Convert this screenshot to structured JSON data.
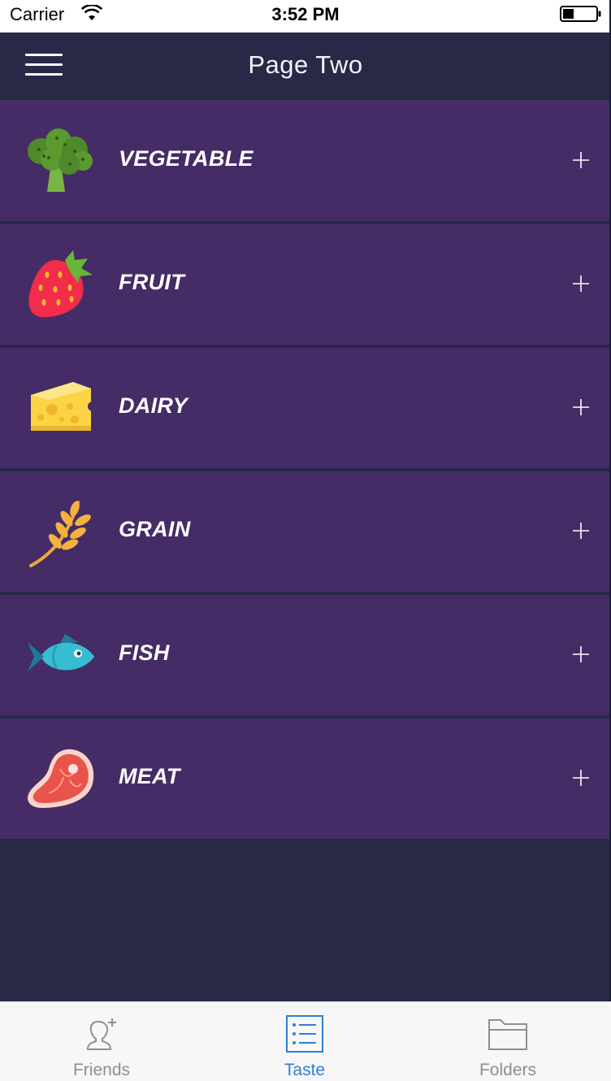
{
  "status_bar": {
    "carrier": "Carrier",
    "time": "3:52 PM"
  },
  "nav": {
    "title": "Page Two",
    "menu_icon": "hamburger-menu-icon"
  },
  "categories": [
    {
      "label": "VEGETABLE",
      "icon": "broccoli-icon"
    },
    {
      "label": "FRUIT",
      "icon": "strawberry-icon"
    },
    {
      "label": "DAIRY",
      "icon": "cheese-icon"
    },
    {
      "label": "GRAIN",
      "icon": "wheat-icon"
    },
    {
      "label": "FISH",
      "icon": "fish-icon"
    },
    {
      "label": "MEAT",
      "icon": "steak-icon"
    }
  ],
  "tabs": [
    {
      "label": "Friends",
      "icon": "add-friend-icon",
      "active": false
    },
    {
      "label": "Taste",
      "icon": "list-icon",
      "active": true
    },
    {
      "label": "Folders",
      "icon": "folder-icon",
      "active": false
    }
  ],
  "colors": {
    "background": "#272946",
    "row": "#452c66",
    "tab_active": "#2d7fd8",
    "tab_inactive": "#8e8e93"
  }
}
